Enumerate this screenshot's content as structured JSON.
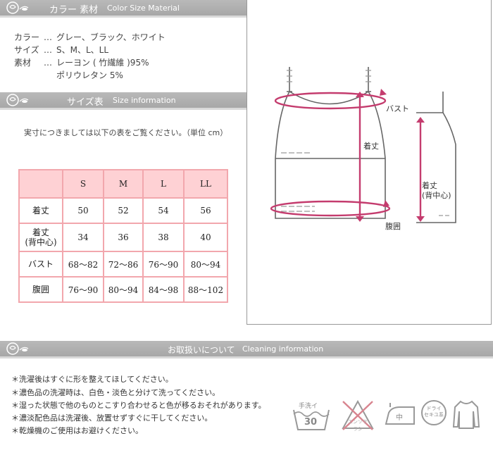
{
  "sections": {
    "material": {
      "jp": "カラー 素材",
      "en": "Color Size Material"
    },
    "size": {
      "jp": "サイズ表",
      "en": "Size information"
    },
    "care": {
      "jp": "お取扱いについて",
      "en": "Cleaning information"
    }
  },
  "specs": [
    {
      "label": "カラー",
      "sep": "…",
      "value": "グレー、ブラック、ホワイト"
    },
    {
      "label": "サイズ",
      "sep": "…",
      "value": "S、M、L、LL"
    },
    {
      "label": "素材",
      "sep": "…",
      "value": "レーヨン ( 竹繊維 )95%"
    },
    {
      "label": "",
      "sep": "",
      "value": "ポリウレタン 5%"
    }
  ],
  "size_note": "実寸につきましては以下の表をご覧ください。（単位 cm）",
  "size_table": {
    "headers": [
      "S",
      "M",
      "L",
      "LL"
    ],
    "rows": [
      {
        "label": "着丈",
        "values": [
          "50",
          "52",
          "54",
          "56"
        ]
      },
      {
        "label": "着丈",
        "label2": "(背中心)",
        "values": [
          "34",
          "36",
          "38",
          "40"
        ]
      },
      {
        "label": "バスト",
        "values": [
          "68～82",
          "72～86",
          "76～90",
          "80～94"
        ]
      },
      {
        "label": "腹囲",
        "values": [
          "76～90",
          "80～94",
          "84～98",
          "88～102"
        ]
      }
    ]
  },
  "diagram": {
    "bust": "バスト",
    "length": "着丈",
    "length_back": "着丈",
    "length_back2": "(背中心)",
    "waist": "腹囲"
  },
  "care_items": [
    "＊洗濯後はすぐに形を整えてほしてください。",
    "＊濃色品の洗濯時は、白色・淡色と分けて洗ってください。",
    "＊湿った状態で他のものとこすり合わせると色が移るおそれがあります。",
    "＊濃淡配色品は洗濯後、放置せずすぐに干してください。",
    "＊乾燥機のご使用はお避けください。"
  ],
  "care_icons": {
    "wash": "手洗イ",
    "wash_temp": "30",
    "bleach": "エンソサラシ",
    "iron": "中",
    "dry": "ドライ",
    "dry2": "セキユ系"
  },
  "colors": {
    "accent_pink": "#f2a7ad",
    "header_fill": "#fed1d4",
    "bar_gray": "#b0b0b0",
    "measure": "#c43c6e"
  }
}
